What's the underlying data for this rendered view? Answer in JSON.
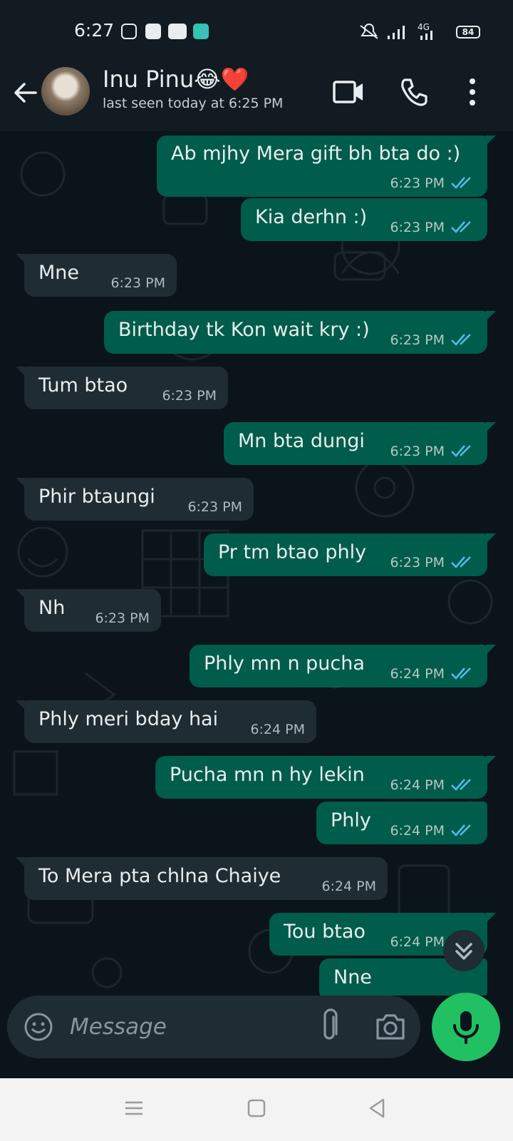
{
  "status_bar": {
    "time": "6:27",
    "network": "4G",
    "battery": "84"
  },
  "header": {
    "contact_name": "Inu Pinu😂❤️",
    "last_seen": "last seen today at 6:25 PM"
  },
  "messages": [
    {
      "dir": "out",
      "text": "Ab mjhy Mera gift bh bta do :)",
      "time": "6:23 PM"
    },
    {
      "dir": "out",
      "text": "Kia derhn :)",
      "time": "6:23 PM"
    },
    {
      "dir": "in",
      "text": "Mne",
      "time": "6:23 PM"
    },
    {
      "dir": "out",
      "text": "Birthday tk Kon wait kry :)",
      "time": "6:23 PM"
    },
    {
      "dir": "in",
      "text": "Tum btao",
      "time": "6:23 PM"
    },
    {
      "dir": "out",
      "text": "Mn bta dungi",
      "time": "6:23 PM"
    },
    {
      "dir": "in",
      "text": "Phir btaungi",
      "time": "6:23 PM"
    },
    {
      "dir": "out",
      "text": "Pr tm btao phly",
      "time": "6:23 PM"
    },
    {
      "dir": "in",
      "text": "Nh",
      "time": "6:23 PM"
    },
    {
      "dir": "out",
      "text": "Phly mn n pucha",
      "time": "6:24 PM"
    },
    {
      "dir": "in",
      "text": "Phly meri bday hai",
      "time": "6:24 PM"
    },
    {
      "dir": "out",
      "text": "Pucha mn n hy lekin",
      "time": "6:24 PM"
    },
    {
      "dir": "out",
      "text": "Phly",
      "time": "6:24 PM"
    },
    {
      "dir": "in",
      "text": "To Mera pta chlna Chaiye",
      "time": "6:24 PM"
    },
    {
      "dir": "out",
      "text": "Tou btao",
      "time": "6:24 PM"
    },
    {
      "dir": "out",
      "text": "Nne",
      "time": ""
    }
  ],
  "composer": {
    "placeholder": "Message"
  },
  "colors": {
    "outgoing_bubble": "#005c4b",
    "incoming_bubble": "#202c33",
    "background": "#0b141a",
    "read_ticks": "#53bdeb",
    "mic_button": "#21c063"
  },
  "icons": {
    "back": "arrow-left-icon",
    "video": "video-call-icon",
    "call": "phone-icon",
    "menu": "more-vertical-icon",
    "emoji": "emoji-icon",
    "attach": "paperclip-icon",
    "camera": "camera-icon",
    "mic": "microphone-icon",
    "scroll": "double-chevron-down-icon"
  }
}
